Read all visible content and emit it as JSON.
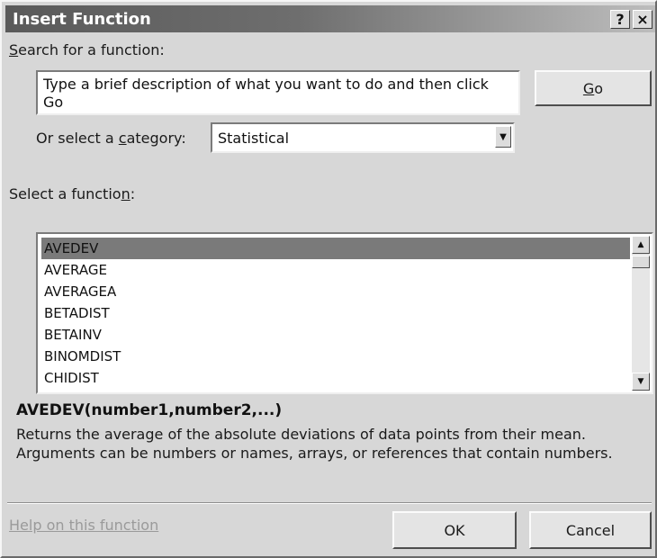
{
  "dialog": {
    "title": "Insert Function",
    "help_button": "?",
    "close_button": "×"
  },
  "search": {
    "label_prefix": "",
    "label_mnemonic": "S",
    "label_rest": "earch for a function:",
    "value": "Type a brief description of what you want to do and then click Go",
    "go_mnemonic": "G",
    "go_rest": "o"
  },
  "category": {
    "label_prefix": "Or select a ",
    "label_mnemonic": "c",
    "label_rest": "ategory:",
    "selected": "Statistical"
  },
  "functions": {
    "label_prefix": "Select a functio",
    "label_mnemonic": "n",
    "label_rest": ":",
    "items": [
      "AVEDEV",
      "AVERAGE",
      "AVERAGEA",
      "BETADIST",
      "BETAINV",
      "BINOMDIST",
      "CHIDIST"
    ],
    "selected_index": 0
  },
  "detail": {
    "signature": "AVEDEV(number1,number2,...)",
    "description": "Returns the average of the absolute deviations of data points from their mean. Arguments can be numbers or names, arrays, or references that contain numbers."
  },
  "footer": {
    "help_link": "Help on this function",
    "ok": "OK",
    "cancel": "Cancel"
  }
}
